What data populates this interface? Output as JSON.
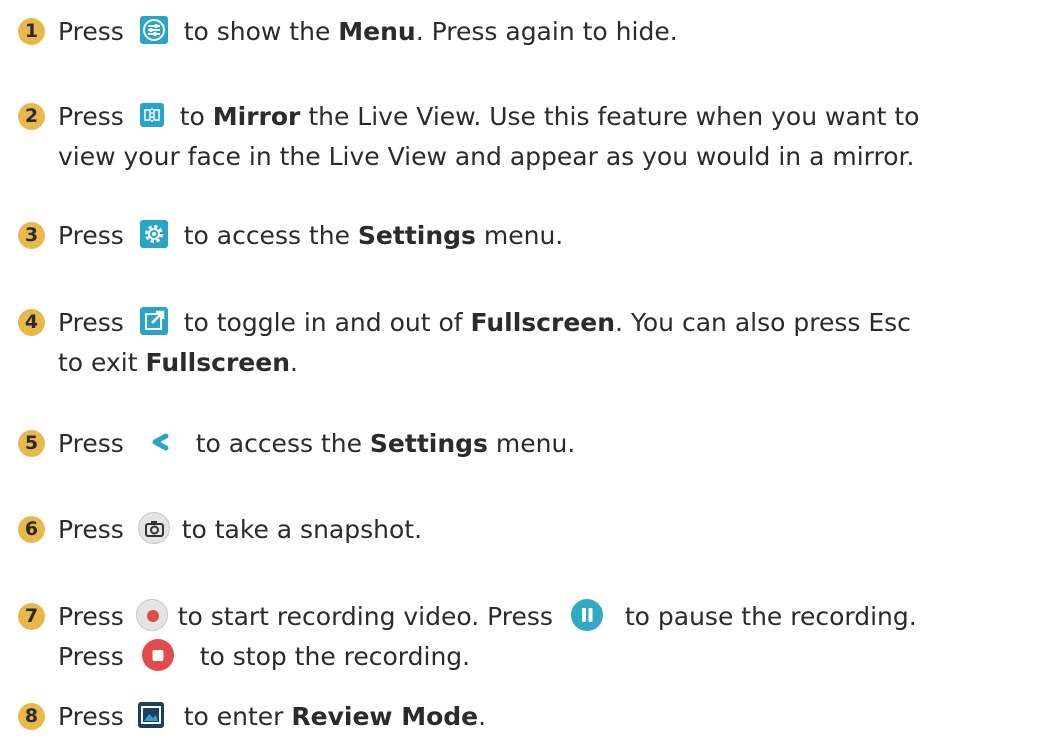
{
  "items": [
    {
      "num": "1",
      "pre": "Press",
      "post": "to show the",
      "bold": "Menu",
      "tail": ". Press again to hide.",
      "icon": "menu-sliders-icon"
    },
    {
      "num": "2",
      "pre": "Press",
      "post": "to",
      "bold": "Mirror",
      "tail": " the Live View. Use this feature when you want to",
      "line2": "view your face in the Live View and appear as you would in a mirror.",
      "icon": "mirror-icon"
    },
    {
      "num": "3",
      "pre": "Press",
      "post": "to access the",
      "bold": "Settings",
      "tail": " menu.",
      "icon": "gear-icon"
    },
    {
      "num": "4",
      "pre": "Press",
      "post": "to toggle in and out of",
      "bold": "Fullscreen",
      "tail": ". You can also press Esc",
      "line2_pre": "to exit",
      "line2_bold": "Fullscreen",
      "line2_tail": ".",
      "icon": "fullscreen-icon"
    },
    {
      "num": "5",
      "pre": "Press",
      "post": "to access the",
      "bold": "Settings",
      "tail": " menu.",
      "icon": "chevron-left-icon"
    },
    {
      "num": "6",
      "pre": "Press",
      "post": "to take a snapshot.",
      "icon": "camera-icon"
    },
    {
      "num": "7",
      "pre": "Press",
      "post": "to start recording video. Press",
      "post2": "to pause the recording.",
      "line2_pre": "Press",
      "line2_post": "to stop the recording.",
      "icon": "record-icon"
    },
    {
      "num": "8",
      "pre": "Press",
      "post": "to enter",
      "bold": "Review Mode",
      "tail": ".",
      "icon": "review-mode-icon"
    }
  ],
  "colors": {
    "badge": "#e8b84a",
    "accent": "#2aa3c9",
    "record": "#e14b4b"
  }
}
